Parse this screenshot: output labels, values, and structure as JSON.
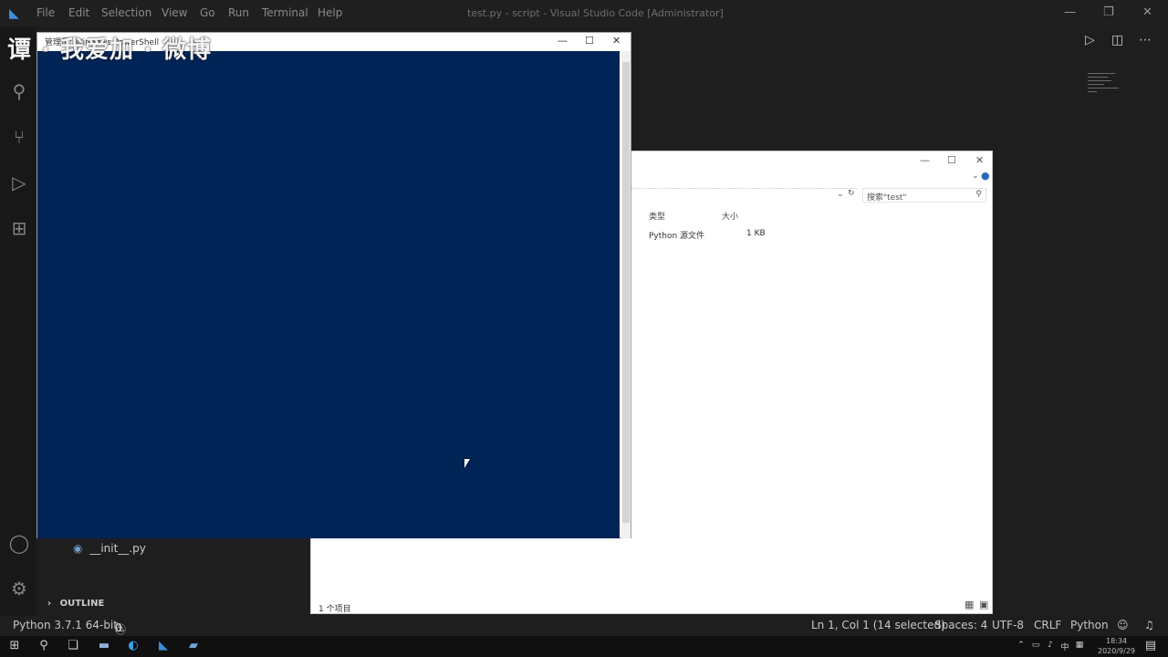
{
  "vscode": {
    "menu": [
      "File",
      "Edit",
      "Selection",
      "View",
      "Go",
      "Run",
      "Terminal",
      "Help"
    ],
    "window_title": "test.py - script - Visual Studio Code [Administrator]",
    "outline_label": "OUTLINE",
    "file_item": "__init__.py"
  },
  "watermark": "谭 · 我爱加 · 微博",
  "powershell": {
    "title": "管理员: Windows PowerShell",
    "console_color": "#012456"
  },
  "explorer": {
    "search_placeholder": "搜索\"test\"",
    "columns": [
      "类型",
      "大小"
    ],
    "rows": [
      {
        "type": "Python 源文件",
        "size": "1 KB"
      }
    ],
    "status": "1 个项目"
  },
  "statusbar": {
    "python": "Python 3.7.1 64-bit",
    "errors": "0",
    "warnings": "0",
    "position": "Ln 1, Col 1 (14 selected)",
    "spaces": "Spaces: 4",
    "encoding": "UTF-8",
    "eol": "CRLF",
    "language": "Python"
  },
  "taskbar": {
    "time": "18:34",
    "date": "2020/9/29"
  }
}
